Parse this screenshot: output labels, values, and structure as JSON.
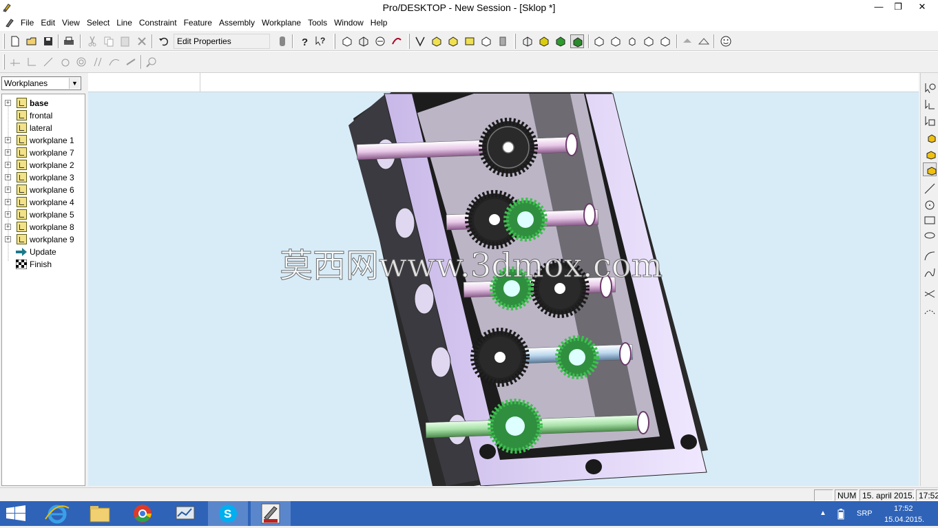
{
  "window": {
    "title": "Pro/DESKTOP - New Session - [Sklop *]",
    "controls": {
      "minimize": "—",
      "maximize": "❐",
      "close": "✕"
    }
  },
  "menu": {
    "items": [
      "File",
      "Edit",
      "View",
      "Select",
      "Line",
      "Constraint",
      "Feature",
      "Assembly",
      "Workplane",
      "Tools",
      "Window",
      "Help"
    ],
    "mdi_controls": {
      "minimize": "_",
      "restore": "❐",
      "close": "✕"
    }
  },
  "toolbar": {
    "edit_properties_label": "Edit Properties"
  },
  "left_panel": {
    "selector_value": "Workplanes",
    "tree": [
      {
        "label": "base",
        "bold": true,
        "expandable": true,
        "icon": "workplane-icon"
      },
      {
        "label": "frontal",
        "bold": false,
        "expandable": false,
        "icon": "workplane-icon"
      },
      {
        "label": "lateral",
        "bold": false,
        "expandable": false,
        "icon": "workplane-icon"
      },
      {
        "label": "workplane 1",
        "bold": false,
        "expandable": true,
        "icon": "workplane-icon"
      },
      {
        "label": "workplane 7",
        "bold": false,
        "expandable": true,
        "icon": "workplane-icon"
      },
      {
        "label": "workplane 2",
        "bold": false,
        "expandable": true,
        "icon": "workplane-icon"
      },
      {
        "label": "workplane 3",
        "bold": false,
        "expandable": true,
        "icon": "workplane-icon"
      },
      {
        "label": "workplane 6",
        "bold": false,
        "expandable": true,
        "icon": "workplane-icon"
      },
      {
        "label": "workplane 4",
        "bold": false,
        "expandable": true,
        "icon": "workplane-icon"
      },
      {
        "label": "workplane 5",
        "bold": false,
        "expandable": true,
        "icon": "workplane-icon"
      },
      {
        "label": "workplane 8",
        "bold": false,
        "expandable": true,
        "icon": "workplane-icon"
      },
      {
        "label": "workplane 9",
        "bold": false,
        "expandable": true,
        "icon": "workplane-icon"
      },
      {
        "label": "Update",
        "bold": false,
        "expandable": false,
        "icon": "update-arrow-icon"
      },
      {
        "label": "Finish",
        "bold": false,
        "expandable": false,
        "icon": "finish-flag-icon"
      }
    ]
  },
  "viewport": {
    "watermark": "莫西网www.3dmox.com",
    "colors": {
      "background": "#d8ecf8",
      "housing": "#e4d8f8",
      "housing_dark": "#2a2a2a",
      "gear_dark": "#222222",
      "gear_green": "#3fbf4f"
    }
  },
  "statusbar": {
    "num": "NUM",
    "date": "15. april 2015.",
    "time": "17:52"
  },
  "taskbar": {
    "language": "SRP",
    "clock_time": "17:52",
    "clock_date": "15.04.2015.",
    "apps": [
      "start-icon",
      "internet-explorer-icon",
      "file-explorer-icon",
      "chrome-icon",
      "network-app-icon",
      "skype-icon",
      "prodesktop-icon"
    ]
  }
}
